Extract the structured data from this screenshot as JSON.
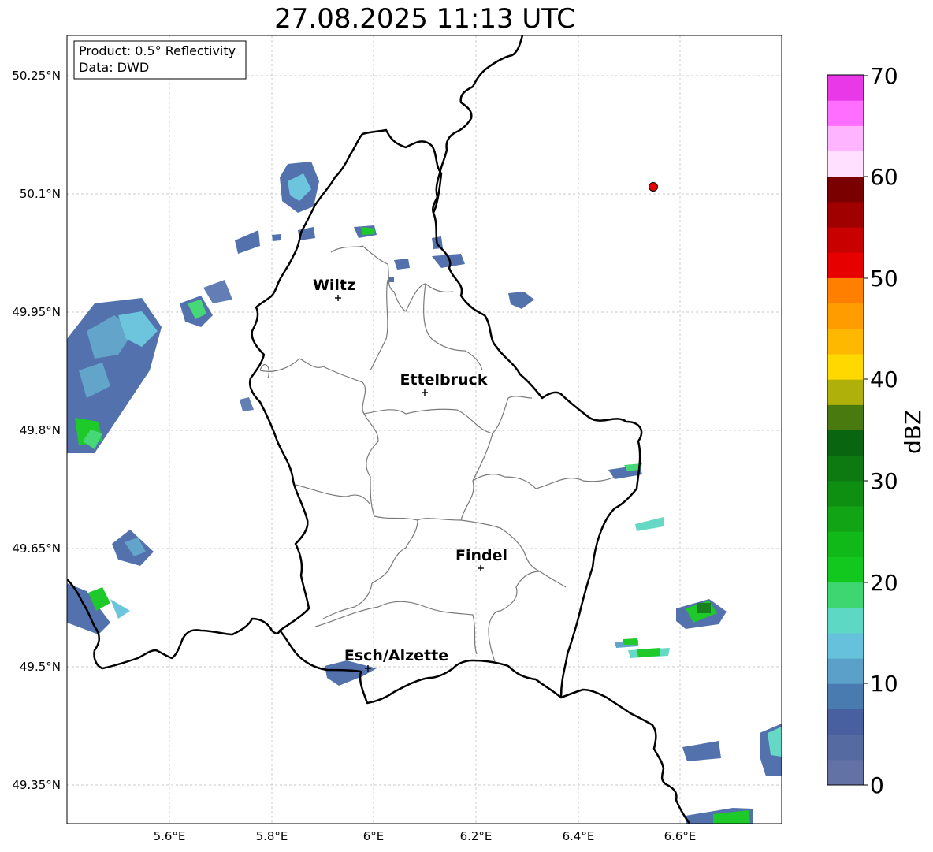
{
  "title": "27.08.2025 11:13 UTC",
  "info_box": {
    "product": "Product: 0.5° Reflectivity",
    "source": "Data: DWD"
  },
  "axes": {
    "x_ticks": [
      "5.6°E",
      "5.8°E",
      "6°E",
      "6.2°E",
      "6.4°E",
      "6.6°E"
    ],
    "y_ticks": [
      "50.25°N",
      "50.1°N",
      "49.95°N",
      "49.8°N",
      "49.65°N",
      "49.5°N",
      "49.35°N"
    ]
  },
  "cities": [
    {
      "name": "Wiltz"
    },
    {
      "name": "Ettelbruck"
    },
    {
      "name": "Findel"
    },
    {
      "name": "Esch/Alzette"
    }
  ],
  "colorbar": {
    "label": "dBZ",
    "ticks": [
      "0",
      "10",
      "20",
      "30",
      "40",
      "50",
      "60",
      "70"
    ],
    "colors": [
      "#6272a4",
      "#566aa2",
      "#4860a0",
      "#4a7bb0",
      "#5aa0c8",
      "#66c2dc",
      "#5dd8c4",
      "#3dd670",
      "#12c81e",
      "#10b818",
      "#11a515",
      "#0f8f12",
      "#0c7a10",
      "#0a6510",
      "#497a10",
      "#b0b00a",
      "#ffd800",
      "#ffb800",
      "#ff9d00",
      "#ff7f00",
      "#e60000",
      "#c80000",
      "#a00000",
      "#7a0000",
      "#ffe0ff",
      "#ffb4ff",
      "#ff6eff",
      "#e838e8"
    ]
  },
  "marker_color": "#e60000"
}
